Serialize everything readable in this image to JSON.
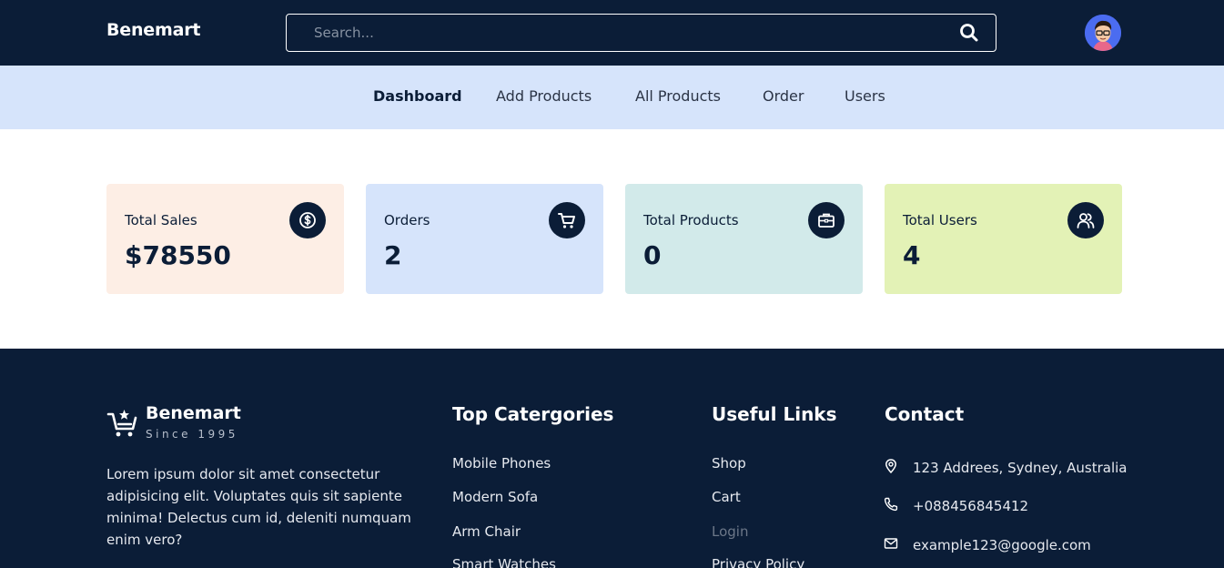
{
  "header": {
    "brand": "Benemart",
    "search": {
      "placeholder": "Search...",
      "icon": "search-icon"
    },
    "avatar_icon": "user-avatar"
  },
  "nav": {
    "items": [
      {
        "label": "Dashboard",
        "active": true
      },
      {
        "label": "Add Products",
        "active": false
      },
      {
        "label": "All Products",
        "active": false
      },
      {
        "label": "Order",
        "active": false
      },
      {
        "label": "Users",
        "active": false
      }
    ]
  },
  "stats": [
    {
      "label": "Total Sales",
      "value": "$78550",
      "icon": "dollar-icon",
      "bg": "#fdeee5"
    },
    {
      "label": "Orders",
      "value": "2",
      "icon": "cart-icon",
      "bg": "#d6e4fb"
    },
    {
      "label": "Total Products",
      "value": "0",
      "icon": "briefcase-icon",
      "bg": "#d2eaea"
    },
    {
      "label": "Total Users",
      "value": "4",
      "icon": "users-icon",
      "bg": "#e3f2b6"
    }
  ],
  "footer": {
    "brand": "Benemart",
    "since": "Since 1995",
    "description": "Lorem ipsum dolor sit amet consectetur adipisicing elit. Voluptates quis sit sapiente minima! Delectus cum id, deleniti numquam enim vero?",
    "categories": {
      "title": "Top Catergories",
      "items": [
        "Mobile Phones",
        "Modern Sofa",
        "Arm Chair",
        "Smart Watches"
      ]
    },
    "links": {
      "title": "Useful Links",
      "items": [
        "Shop",
        "Cart",
        "Login",
        "Privacy Policy"
      ]
    },
    "contact": {
      "title": "Contact",
      "address": "123 Addrees, Sydney, Australia",
      "phone": "+088456845412",
      "email": "example123@google.com"
    }
  },
  "colors": {
    "navy": "#0b1d37",
    "nav_bg": "#d6e4fb"
  }
}
